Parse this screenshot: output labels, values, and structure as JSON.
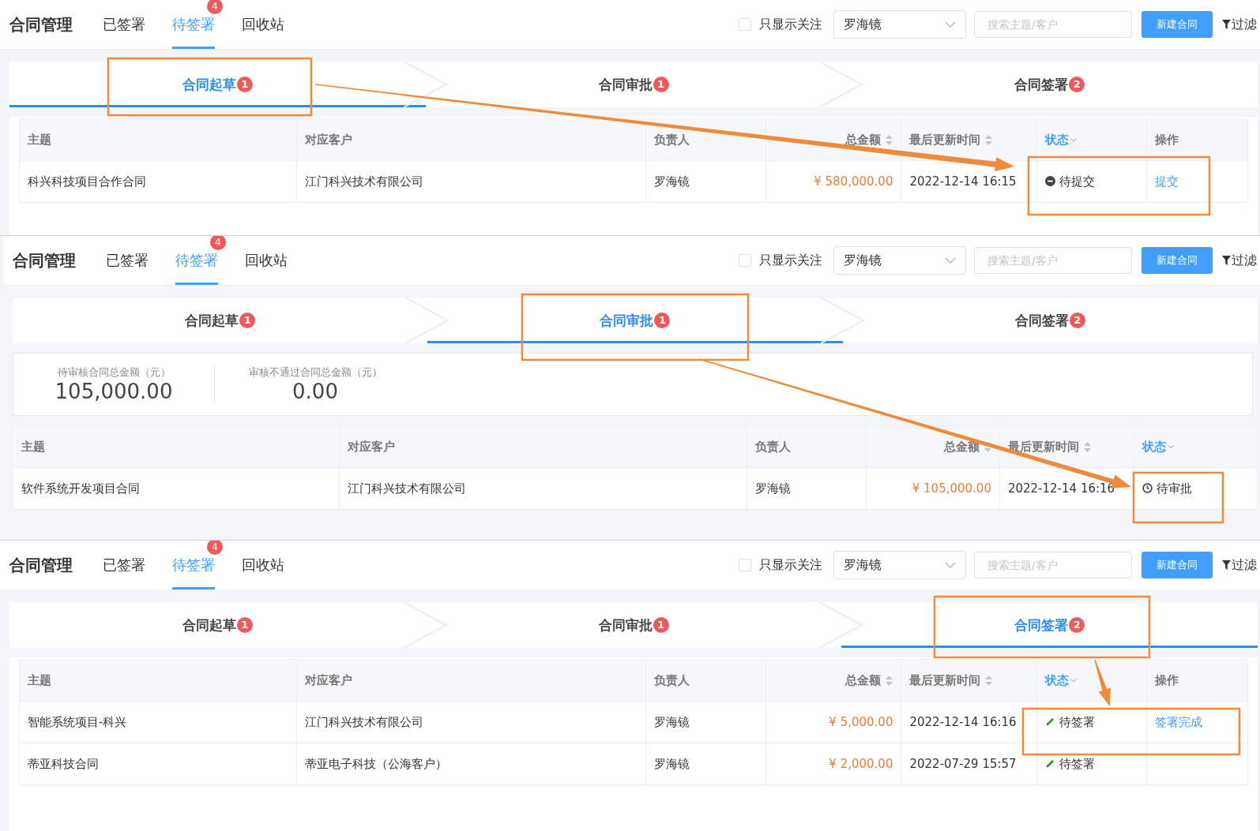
{
  "panels": [
    {
      "header": {
        "title": "合同管理",
        "tabs": [
          {
            "label": "已签署",
            "selected": false
          },
          {
            "label": "待签署",
            "selected": true,
            "badge": "4"
          },
          {
            "label": "回收站",
            "selected": false
          }
        ],
        "follow": {
          "label": "只显示关注",
          "checked": false
        },
        "owner": "罗海镜",
        "search_placeholder": "搜索主题/客户",
        "new_button": "新建合同",
        "filter": "过滤"
      },
      "steps": [
        {
          "label": "合同起草",
          "count": "1",
          "selected": true
        },
        {
          "label": "合同审批",
          "count": "1",
          "selected": false
        },
        {
          "label": "合同签署",
          "count": "2",
          "selected": false
        }
      ],
      "table": {
        "columns": [
          {
            "label": "主题",
            "kind": "text"
          },
          {
            "label": "对应客户",
            "kind": "text"
          },
          {
            "label": "负责人",
            "kind": "text"
          },
          {
            "label": "总金额",
            "kind": "money"
          },
          {
            "label": "最后更新时间",
            "kind": "time"
          },
          {
            "label": "状态",
            "kind": "status"
          },
          {
            "label": "操作",
            "kind": "action"
          }
        ],
        "rows": [
          {
            "cells": [
              "科兴科技项目合作合同",
              "江门科兴技术有限公司",
              "罗海镜",
              "¥ 580,000.00",
              "2022-12-14 16:15",
              {
                "label": "待提交",
                "kind": "draft"
              },
              "提交"
            ]
          }
        ]
      }
    },
    {
      "header": {
        "title": "合同管理",
        "tabs": [
          {
            "label": "已签署",
            "selected": false
          },
          {
            "label": "待签署",
            "selected": true,
            "badge": "4"
          },
          {
            "label": "回收站",
            "selected": false
          }
        ],
        "follow": {
          "label": "只显示关注",
          "checked": false
        },
        "owner": "罗海镜",
        "search_placeholder": "搜索主题/客户",
        "new_button": "新建合同",
        "filter": "过滤"
      },
      "steps": [
        {
          "label": "合同起草",
          "count": "1",
          "selected": false
        },
        {
          "label": "合同审批",
          "count": "1",
          "selected": true
        },
        {
          "label": "合同签署",
          "count": "2",
          "selected": false
        }
      ],
      "summary": [
        {
          "label": "待审核合同总金额（元）",
          "value": "105,000.00"
        },
        {
          "label": "审核不通过合同总金额（元）",
          "value": "0.00"
        }
      ],
      "table": {
        "columns": [
          {
            "label": "主题",
            "kind": "text"
          },
          {
            "label": "对应客户",
            "kind": "text"
          },
          {
            "label": "负责人",
            "kind": "text"
          },
          {
            "label": "总金额",
            "kind": "money"
          },
          {
            "label": "最后更新时间",
            "kind": "time"
          },
          {
            "label": "状态",
            "kind": "status"
          }
        ],
        "rows": [
          {
            "cells": [
              "软件系统开发项目合同",
              "江门科兴技术有限公司",
              "罗海镜",
              "¥ 105,000.00",
              "2022-12-14 16:16",
              {
                "label": "待审批",
                "kind": "approval"
              }
            ]
          }
        ]
      }
    },
    {
      "header": {
        "title": "合同管理",
        "tabs": [
          {
            "label": "已签署",
            "selected": false
          },
          {
            "label": "待签署",
            "selected": true,
            "badge": "4"
          },
          {
            "label": "回收站",
            "selected": false
          }
        ],
        "follow": {
          "label": "只显示关注",
          "checked": false
        },
        "owner": "罗海镜",
        "search_placeholder": "搜索主题/客户",
        "new_button": "新建合同",
        "filter": "过滤"
      },
      "steps": [
        {
          "label": "合同起草",
          "count": "1",
          "selected": false
        },
        {
          "label": "合同审批",
          "count": "1",
          "selected": false
        },
        {
          "label": "合同签署",
          "count": "2",
          "selected": true
        }
      ],
      "table": {
        "columns": [
          {
            "label": "主题",
            "kind": "text"
          },
          {
            "label": "对应客户",
            "kind": "text"
          },
          {
            "label": "负责人",
            "kind": "text"
          },
          {
            "label": "总金额",
            "kind": "money"
          },
          {
            "label": "最后更新时间",
            "kind": "time"
          },
          {
            "label": "状态",
            "kind": "status"
          },
          {
            "label": "操作",
            "kind": "action"
          }
        ],
        "rows": [
          {
            "cells": [
              "智能系统项目-科兴",
              "江门科兴技术有限公司",
              "罗海镜",
              "¥ 5,000.00",
              "2022-12-14 16:16",
              {
                "label": "待签署",
                "kind": "signing"
              },
              "签署完成"
            ]
          },
          {
            "cells": [
              "蒂亚科技合同",
              "蒂亚电子科技（公海客户）",
              "罗海镜",
              "¥ 2,000.00",
              "2022-07-29 15:57",
              {
                "label": "待签署",
                "kind": "signing"
              }
            ]
          }
        ]
      }
    }
  ]
}
